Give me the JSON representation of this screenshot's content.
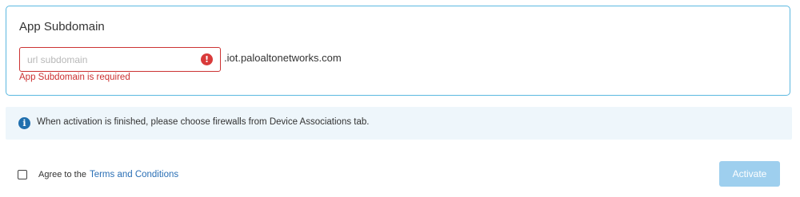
{
  "subdomain_card": {
    "title": "App Subdomain",
    "input": {
      "value": "",
      "placeholder": "url subdomain"
    },
    "error_icon": "exclamation-circle-icon",
    "error_icon_glyph": "!",
    "domain_suffix": ".iot.paloaltonetworks.com",
    "error_message": "App Subdomain is required"
  },
  "info_banner": {
    "icon": "info-circle-icon",
    "icon_glyph": "i",
    "text": "When activation is finished, please choose firewalls from Device Associations tab."
  },
  "agreement": {
    "checked": false,
    "prefix": "Agree to the",
    "link_text": "Terms and Conditions"
  },
  "activate_button": {
    "label": "Activate",
    "disabled": true
  },
  "colors": {
    "card_border": "#5bb8e0",
    "error": "#cc3333",
    "info_bg": "#eef6fb",
    "info_icon": "#1f6fae",
    "link": "#2a6fb5",
    "button_disabled": "#9ecfee"
  }
}
